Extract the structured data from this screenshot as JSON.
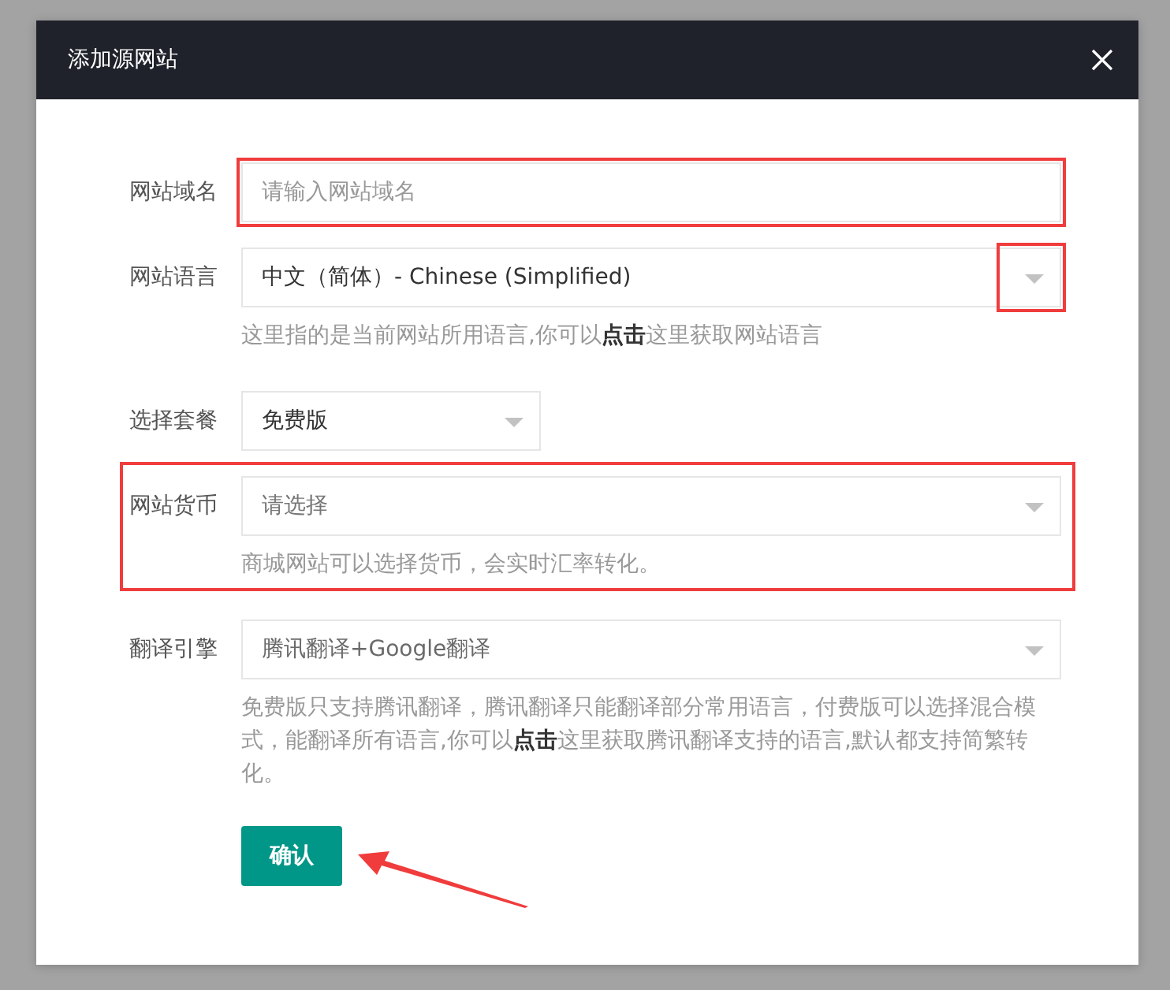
{
  "dialog": {
    "title": "添加源网站",
    "fields": [
      {
        "kind": "text",
        "label": "网站域名",
        "placeholder": "请输入网站域名",
        "highlighted": true
      },
      {
        "kind": "select",
        "label": "网站语言",
        "value": "中文（简体）- Chinese (Simplified)",
        "disabled": false,
        "hint": "这里指的是当前网站所用语言,你可以**点击**这里获取网站语言",
        "arrow_highlighted": true
      },
      {
        "kind": "short-select",
        "label": "选择套餐",
        "value": "免费版",
        "disabled": false
      },
      {
        "kind": "select",
        "label": "网站货币",
        "placeholder": "请选择",
        "disabled": false,
        "hint": "商城网站可以选择货币，会实时汇率转化。",
        "row_highlighted": true
      },
      {
        "kind": "select",
        "label": "翻译引擎",
        "value": "腾讯翻译+Google翻译",
        "disabled": true,
        "hint": "免费版只支持腾讯翻译，腾讯翻译只能翻译部分常用语言，付费版可以选择混合模式，能翻译所有语言,你可以**点击**这里获取腾讯翻译支持的语言,默认都支持简繁转化。"
      }
    ],
    "confirm_button": {
      "label": "确认",
      "pointer_arrow": true
    }
  }
}
